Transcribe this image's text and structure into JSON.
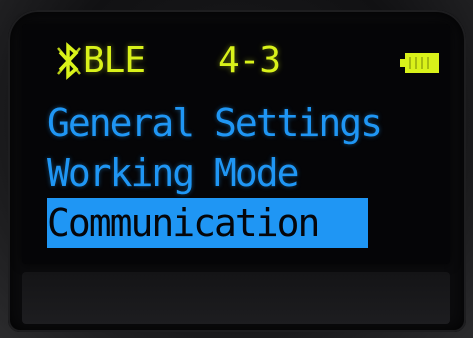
{
  "status": {
    "bluetooth_icon": "bluetooth-icon",
    "connection": "BLE",
    "page": "4-3",
    "battery_icon": "battery-icon",
    "text_color": "#d9f21a"
  },
  "menu": {
    "items": [
      {
        "label": "General Settings",
        "selected": false
      },
      {
        "label": "Working Mode",
        "selected": false
      },
      {
        "label": "Communication",
        "selected": true
      }
    ],
    "text_color": "#1f96f4",
    "highlight_color": "#1f96f4"
  }
}
